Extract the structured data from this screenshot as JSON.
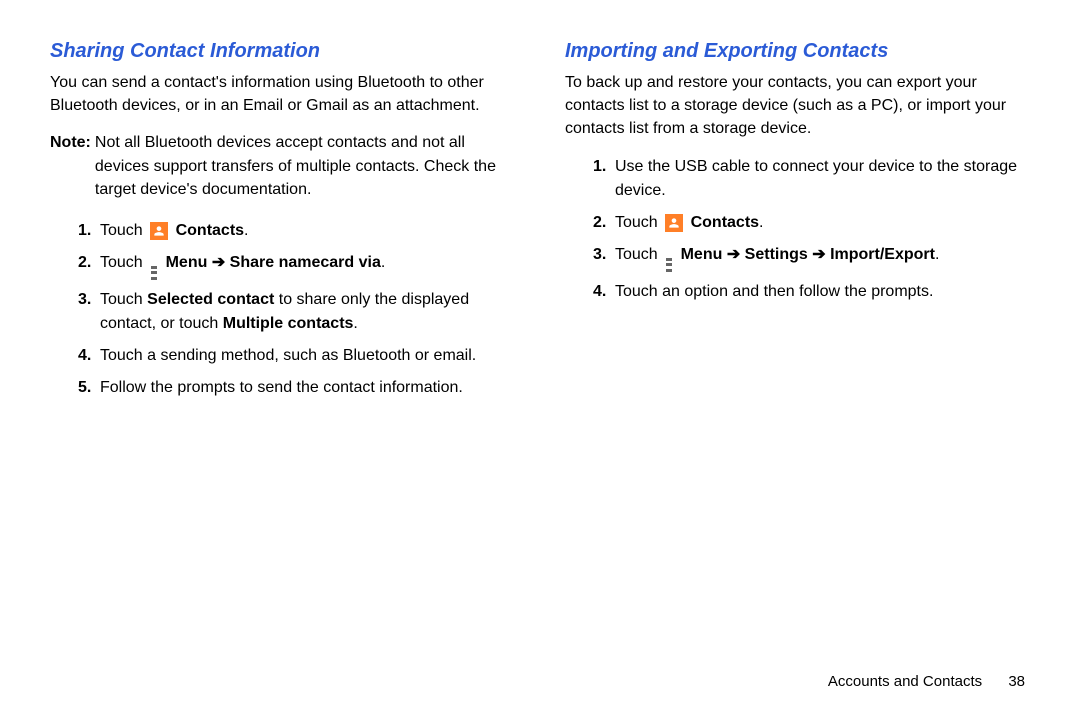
{
  "left": {
    "title": "Sharing Contact Information",
    "intro": "You can send a contact's information using Bluetooth to other Bluetooth devices, or in an Email or Gmail as an attachment.",
    "note_label": "Note:",
    "note_text": "Not all Bluetooth devices accept contacts and not all devices support transfers of multiple contacts. Check the target device's documentation.",
    "step1_touch": "Touch ",
    "step1_contacts": "Contacts",
    "step1_end": ".",
    "step2_touch": "Touch ",
    "step2_menu": "Menu ➔ Share namecard via",
    "step2_end": ".",
    "step3_a": "Touch ",
    "step3_b": "Selected contact",
    "step3_c": " to share only the displayed contact, or touch ",
    "step3_d": "Multiple contacts",
    "step3_e": ".",
    "step4": "Touch a sending method, such as Bluetooth or email.",
    "step5": "Follow the prompts to send the contact information."
  },
  "right": {
    "title": "Importing and Exporting Contacts",
    "intro": "To back up and restore your contacts, you can export your contacts list to a storage device (such as a PC), or import your contacts list from a storage device.",
    "step1": "Use the USB cable to connect your device to the storage device.",
    "step2_touch": "Touch ",
    "step2_contacts": "Contacts",
    "step2_end": ".",
    "step3_touch": "Touch ",
    "step3_menu": "Menu ➔ Settings ➔ Import/Export",
    "step3_end": ".",
    "step4": "Touch an option and then follow the prompts."
  },
  "footer": {
    "chapter": "Accounts and Contacts",
    "page": "38"
  }
}
